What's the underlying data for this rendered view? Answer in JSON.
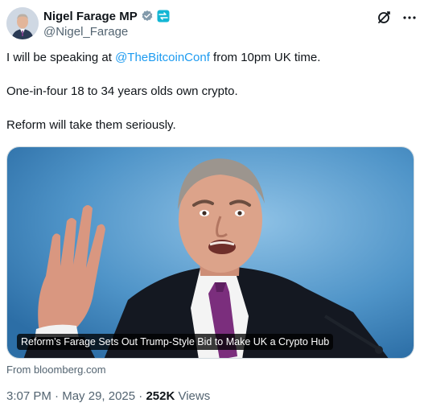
{
  "author": {
    "display_name": "Nigel Farage MP",
    "handle": "@Nigel_Farage"
  },
  "icons": {
    "verified": "verified-badge-icon",
    "affiliate": "affiliate-badge-icon",
    "grok": "grok-icon",
    "more": "more-icon"
  },
  "tweet": {
    "line1_before": "I will be speaking at ",
    "line1_mention": "@TheBitcoinConf",
    "line1_after": " from 10pm UK time.",
    "line2": "One-in-four 18 to 34 years olds own crypto.",
    "line3": "Reform will take them seriously."
  },
  "card": {
    "title": "Reform’s Farage Sets Out Trump-Style Bid to Make UK a Crypto Hub",
    "source": "From bloomberg.com"
  },
  "meta": {
    "time": "3:07 PM",
    "separator": " · ",
    "date": "May 29, 2025",
    "views_count": "252K",
    "views_label": " Views"
  },
  "colors": {
    "mention": "#1d9bf0",
    "secondary_text": "#536471",
    "verified": "#829aab"
  }
}
